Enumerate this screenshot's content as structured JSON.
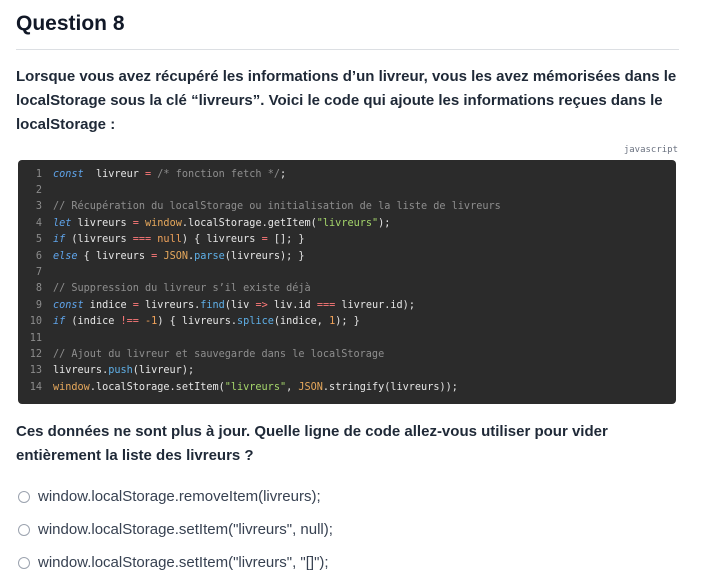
{
  "question": {
    "title": "Question 8",
    "intro_lines": [
      "Lorsque vous avez récupéré les informations d’un livreur, vous les avez mémorisées dans le",
      "localStorage sous la clé “livreurs”. Voici le code qui ajoute les informations reçues dans le",
      "localStorage :"
    ],
    "code_language": "javascript",
    "code_lines": [
      {
        "n": "1",
        "tokens": [
          [
            "kw",
            "const"
          ],
          [
            "",
            "  livreur "
          ],
          [
            "op",
            "="
          ],
          [
            "cm",
            " /* fonction fetch */"
          ],
          [
            "",
            ";"
          ]
        ]
      },
      {
        "n": "2",
        "tokens": []
      },
      {
        "n": "3",
        "tokens": [
          [
            "cm",
            "// Récupération du localStorage ou initialisation de la liste de livreurs"
          ]
        ]
      },
      {
        "n": "4",
        "tokens": [
          [
            "kw",
            "let"
          ],
          [
            "",
            " livreurs "
          ],
          [
            "op",
            "="
          ],
          [
            "",
            " "
          ],
          [
            "gl",
            "window"
          ],
          [
            "",
            ".localStorage.getItem("
          ],
          [
            "st",
            "\"livreurs\""
          ],
          [
            "",
            ");"
          ]
        ]
      },
      {
        "n": "5",
        "tokens": [
          [
            "kw",
            "if"
          ],
          [
            "",
            " (livreurs "
          ],
          [
            "op",
            "==="
          ],
          [
            "",
            " "
          ],
          [
            "nm",
            "null"
          ],
          [
            "",
            ") { livreurs "
          ],
          [
            "op",
            "="
          ],
          [
            "",
            " []; }"
          ]
        ]
      },
      {
        "n": "6",
        "tokens": [
          [
            "kw",
            "else"
          ],
          [
            "",
            " { livreurs "
          ],
          [
            "op",
            "="
          ],
          [
            "",
            " "
          ],
          [
            "gl",
            "JSON"
          ],
          [
            "",
            "."
          ],
          [
            "fn",
            "parse"
          ],
          [
            "",
            "(livreurs); }"
          ]
        ]
      },
      {
        "n": "7",
        "tokens": []
      },
      {
        "n": "8",
        "tokens": [
          [
            "cm",
            "// Suppression du livreur s’il existe déjà"
          ]
        ]
      },
      {
        "n": "9",
        "tokens": [
          [
            "kw",
            "const"
          ],
          [
            "",
            " indice "
          ],
          [
            "op",
            "="
          ],
          [
            "",
            " livreurs."
          ],
          [
            "fn",
            "find"
          ],
          [
            "",
            "(liv "
          ],
          [
            "op",
            "=>"
          ],
          [
            "",
            " liv.id "
          ],
          [
            "op",
            "==="
          ],
          [
            "",
            " livreur.id);"
          ]
        ]
      },
      {
        "n": "10",
        "tokens": [
          [
            "kw",
            "if"
          ],
          [
            "",
            " (indice "
          ],
          [
            "op",
            "!=="
          ],
          [
            "",
            " "
          ],
          [
            "nm",
            "-1"
          ],
          [
            "",
            ") { livreurs."
          ],
          [
            "fn",
            "splice"
          ],
          [
            "",
            "(indice, "
          ],
          [
            "nm",
            "1"
          ],
          [
            "",
            "); }"
          ]
        ]
      },
      {
        "n": "11",
        "tokens": []
      },
      {
        "n": "12",
        "tokens": [
          [
            "cm",
            "// Ajout du livreur et sauvegarde dans le localStorage"
          ]
        ]
      },
      {
        "n": "13",
        "tokens": [
          [
            "",
            "livreurs."
          ],
          [
            "fn",
            "push"
          ],
          [
            "",
            "(livreur);"
          ]
        ]
      },
      {
        "n": "14",
        "tokens": [
          [
            "gl",
            "window"
          ],
          [
            "",
            ".localStorage.setItem("
          ],
          [
            "st",
            "\"livreurs\""
          ],
          [
            "",
            ", "
          ],
          [
            "gl",
            "JSON"
          ],
          [
            "",
            ".stringify(livreurs));"
          ]
        ]
      }
    ],
    "prompt_lines": [
      "Ces données ne sont plus à jour. Quelle ligne de code allez-vous utiliser pour vider",
      "entièrement la liste des livreurs ?"
    ],
    "options": [
      "window.localStorage.removeItem(livreurs);",
      "window.localStorage.setItem(\"livreurs\", null);",
      "window.localStorage.setItem(\"livreurs\", \"[]\");"
    ]
  }
}
